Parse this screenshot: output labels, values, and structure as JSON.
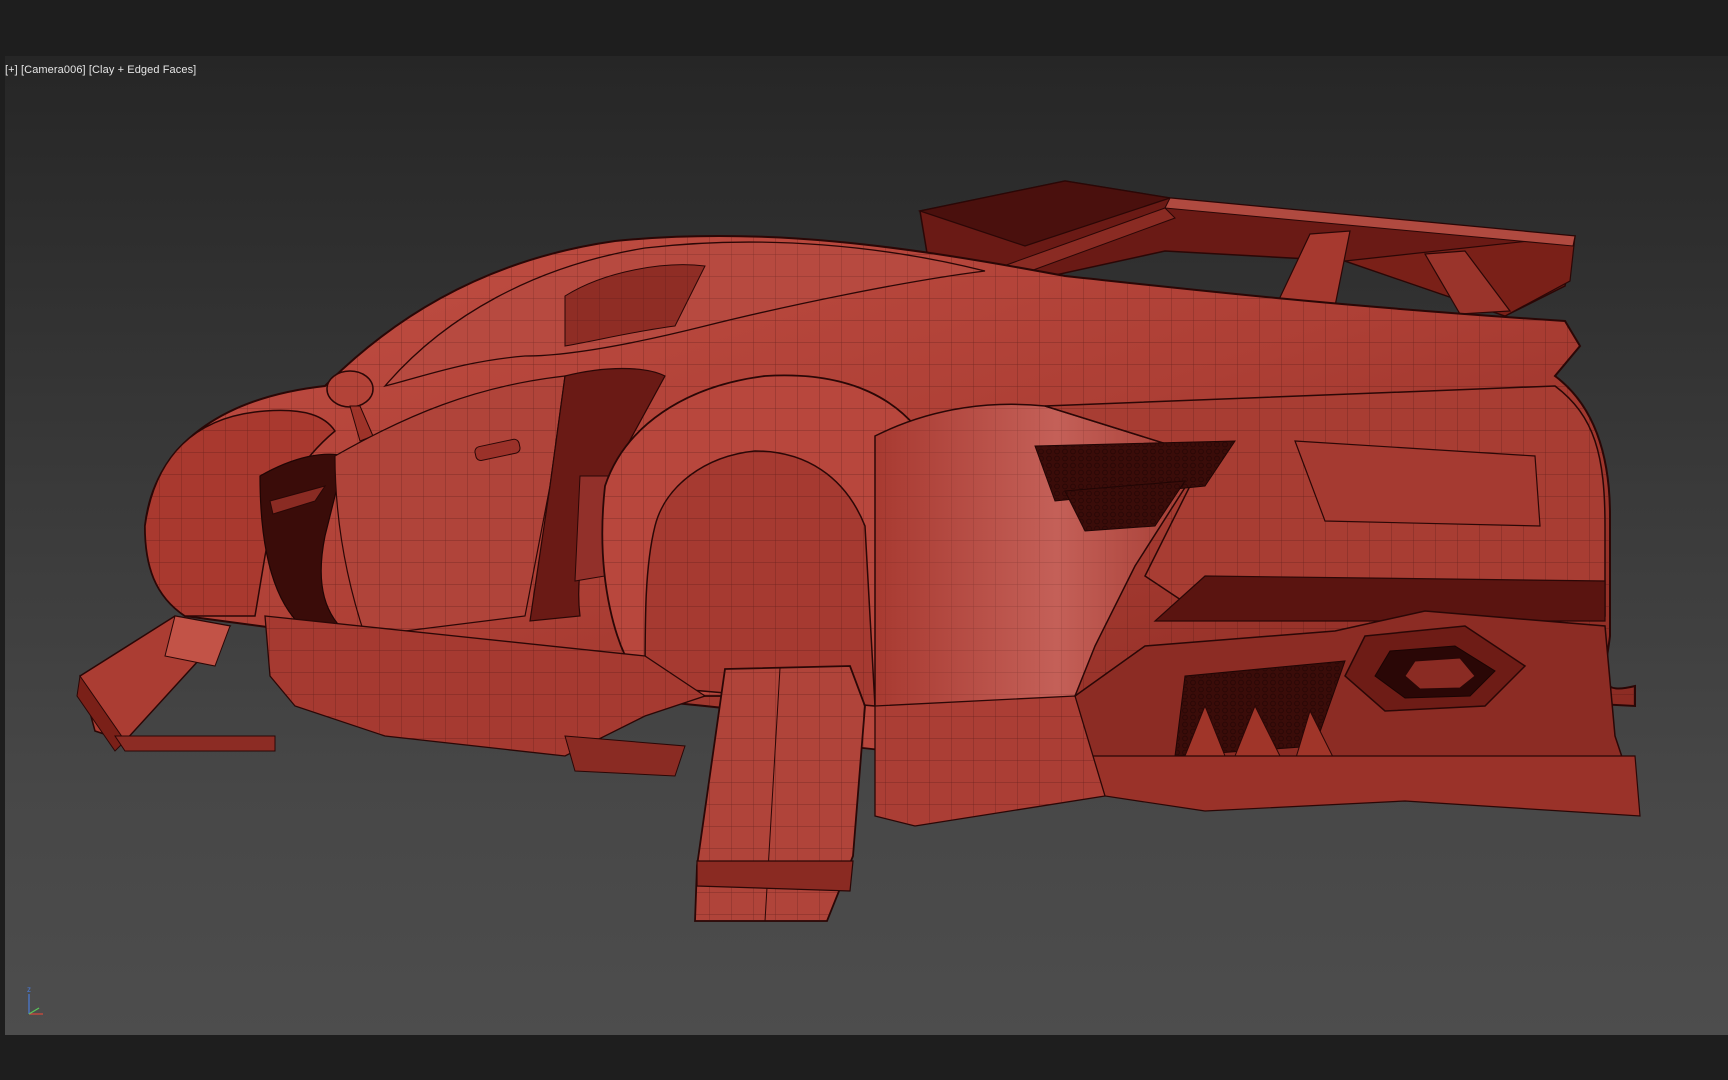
{
  "viewport": {
    "label": {
      "plus": "[+]",
      "camera": "[Camera006]",
      "shading": "[Clay + Edged Faces]"
    },
    "background_color": "#2b2b2b",
    "model": {
      "color": "#b8443a",
      "edge_color": "#3a0f0c"
    },
    "axis_gizmo": {
      "z_label": "z",
      "z_color": "#4a7bd8",
      "x_color": "#d84a3a",
      "y_color": "#5ac85a"
    }
  }
}
